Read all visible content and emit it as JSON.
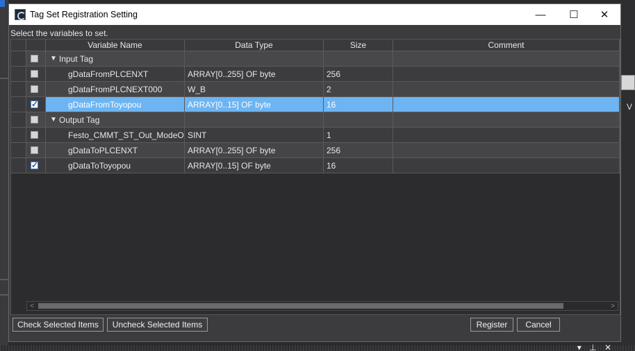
{
  "window": {
    "title": "Tag Set Registration Setting",
    "minimize_glyph": "—",
    "maximize_glyph": "☐",
    "close_glyph": "✕"
  },
  "instruction": "Select the variables to set.",
  "columns": {
    "variable_name": "Variable Name",
    "data_type": "Data Type",
    "size": "Size",
    "comment": "Comment"
  },
  "groups": {
    "input": {
      "label": "Input Tag",
      "rows": [
        {
          "name": "gDataFromPLCENXT",
          "type": "ARRAY[0..255] OF byte",
          "size": "256",
          "comment": "",
          "checked": false
        },
        {
          "name": "gDataFromPLCNEXT000",
          "type": "W_B",
          "size": "2",
          "comment": "",
          "checked": false
        },
        {
          "name": "gDataFromToyopou",
          "type": "ARRAY[0..15] OF byte",
          "size": "16",
          "comment": "",
          "checked": true
        }
      ]
    },
    "output": {
      "label": "Output Tag",
      "rows": [
        {
          "name": "Festo_CMMT_ST_Out_ModeOpe",
          "type": "SINT",
          "size": "1",
          "comment": "",
          "checked": false
        },
        {
          "name": "gDataToPLCENXT",
          "type": "ARRAY[0..255] OF byte",
          "size": "256",
          "comment": "",
          "checked": false
        },
        {
          "name": "gDataToToyopou",
          "type": "ARRAY[0..15] OF byte",
          "size": "16",
          "comment": "",
          "checked": true
        }
      ]
    }
  },
  "scrollbar": {
    "left_glyph": "<",
    "right_glyph": ">"
  },
  "buttons": {
    "check_selected": "Check Selected Items",
    "uncheck_selected": "Uncheck Selected Items",
    "register": "Register",
    "cancel": "Cancel"
  },
  "background": {
    "right_letter": "V",
    "bottom_icons": "▾ ⊥ ✕"
  },
  "colors": {
    "selection": "#6db4f2",
    "dialog_bg": "#3c3c3f",
    "titlebar_bg": "#ffffff"
  }
}
